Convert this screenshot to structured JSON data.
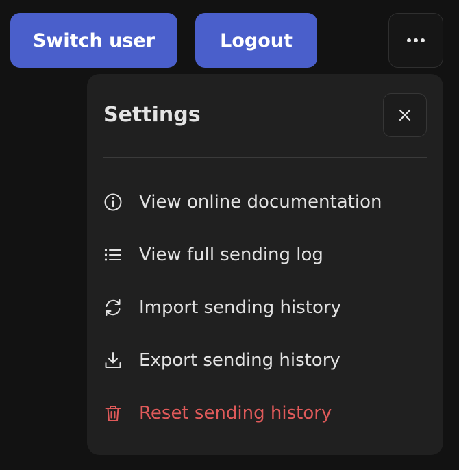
{
  "header": {
    "switch_user_label": "Switch user",
    "logout_label": "Logout",
    "more_icon": "more-horizontal-icon"
  },
  "settings": {
    "title": "Settings",
    "close_icon": "close-icon",
    "items": [
      {
        "label": "View online documentation",
        "icon": "info-icon"
      },
      {
        "label": "View full sending log",
        "icon": "list-icon"
      },
      {
        "label": "Import sending history",
        "icon": "refresh-icon"
      },
      {
        "label": "Export sending history",
        "icon": "download-icon"
      },
      {
        "label": "Reset sending history",
        "icon": "trash-icon",
        "color": "#E05A5A"
      }
    ]
  },
  "colors": {
    "background": "#121212",
    "panel": "#202020",
    "primary_button": "#4A5FCB",
    "danger": "#E05A5A"
  }
}
